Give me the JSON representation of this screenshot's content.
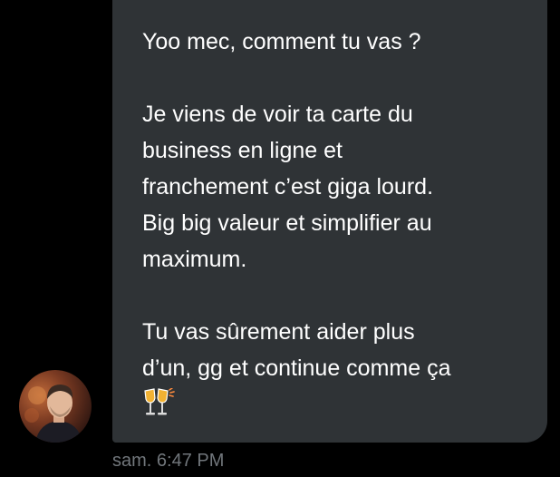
{
  "message": {
    "paragraphs": [
      [
        "Yoo mec, comment tu vas ?"
      ],
      [
        "Je viens de voir ta carte du",
        "business en ligne et",
        "franchement c’est giga lourd.",
        "Big big valeur et simplifier au",
        "maximum."
      ],
      [
        "Tu vas sûrement aider plus",
        "d’un, gg et continue comme ça"
      ]
    ],
    "emoji": "clinking-glasses-icon"
  },
  "sender": {
    "avatar": "avatar"
  },
  "timestamp": "sam. 6:47 PM",
  "colors": {
    "background": "#000000",
    "bubble": "#2f3336",
    "text": "#ffffff",
    "timestamp": "#71767b",
    "champagne": "#f2b233"
  }
}
